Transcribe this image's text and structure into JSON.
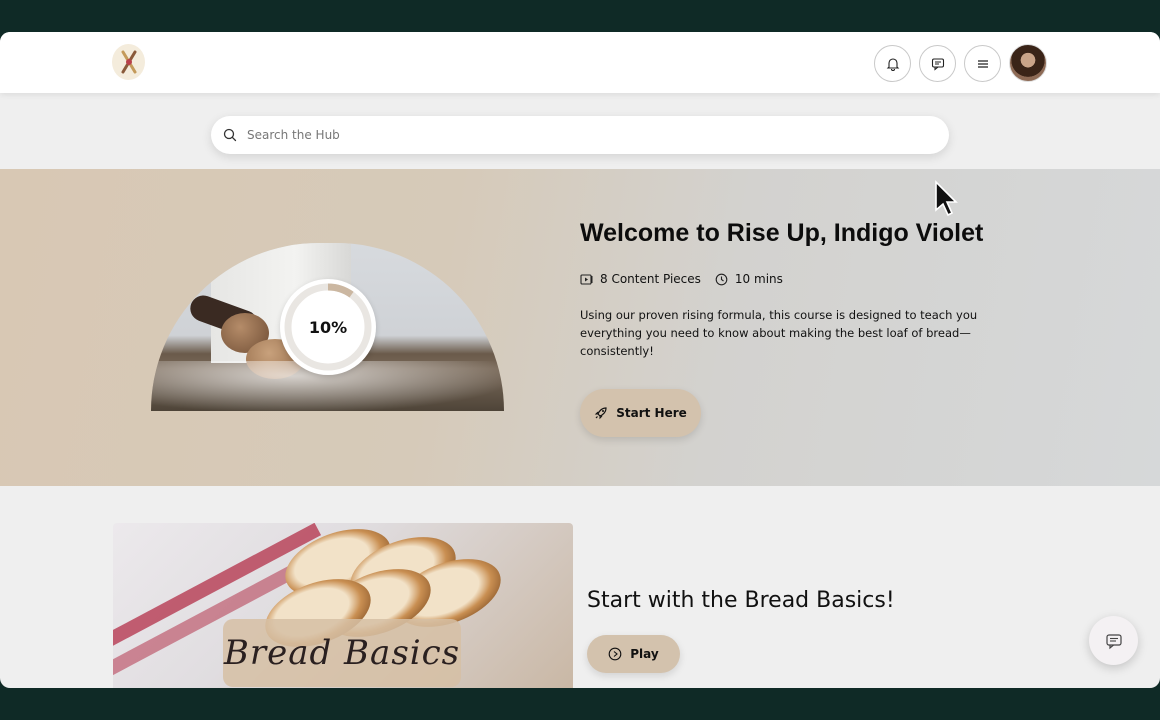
{
  "search": {
    "placeholder": "Search the Hub"
  },
  "hero": {
    "title": "Welcome to Rise Up, Indigo Violet",
    "content_count": "8 Content Pieces",
    "duration": "10 mins",
    "description": "Using our proven rising formula, this course is designed to teach you everything you need to know about making the best loaf of bread—consistently!",
    "progress_label": "10%",
    "progress_value": 0.1,
    "start_button": "Start Here"
  },
  "section": {
    "title": "Start with the Bread Basics!",
    "play_button": "Play",
    "image_caption": "Bread Basics"
  },
  "colors": {
    "accent": "#d3c2ad",
    "hero_bg": "#d8c8b4",
    "frame": "#0f2a26"
  },
  "icons": {
    "header": [
      "bell-icon",
      "chat-icon",
      "menu-icon"
    ],
    "search": "search-icon",
    "content": "video-icon",
    "duration": "clock-icon",
    "start": "rocket-icon",
    "play": "play-circle-icon",
    "fab": "chat-icon"
  }
}
